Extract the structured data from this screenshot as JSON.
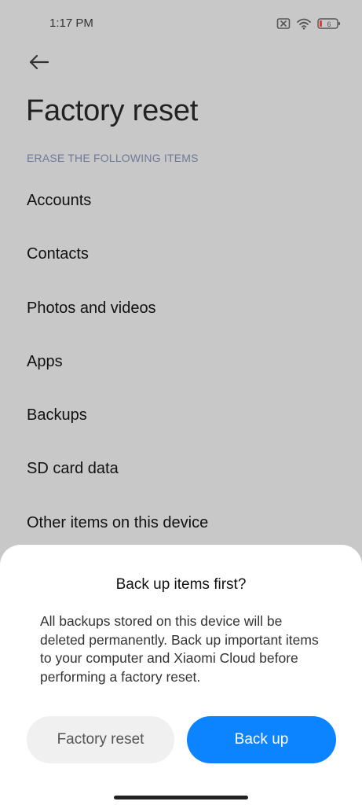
{
  "status_bar": {
    "time": "1:17 PM",
    "battery_level": "6",
    "icons": [
      "no-sim-icon",
      "wifi-icon",
      "battery-icon"
    ]
  },
  "header": {
    "back_icon": "back-arrow-icon",
    "title": "Factory reset"
  },
  "section": {
    "header": "ERASE THE FOLLOWING ITEMS",
    "items": [
      {
        "label": "Accounts"
      },
      {
        "label": "Contacts"
      },
      {
        "label": "Photos and videos"
      },
      {
        "label": "Apps"
      },
      {
        "label": "Backups"
      },
      {
        "label": "SD card data"
      },
      {
        "label": "Other items on this device"
      }
    ]
  },
  "dialog": {
    "title": "Back up items first?",
    "message": "All backups stored on this device will be deleted permanently. Back up important items to your computer and Xiaomi Cloud before performing a factory reset.",
    "secondary_button": "Factory reset",
    "primary_button": "Back up"
  },
  "colors": {
    "primary": "#0d84ff",
    "overlay_background": "#c8c8c8",
    "section_header": "#6f7a99",
    "battery_low": "#e53935"
  }
}
